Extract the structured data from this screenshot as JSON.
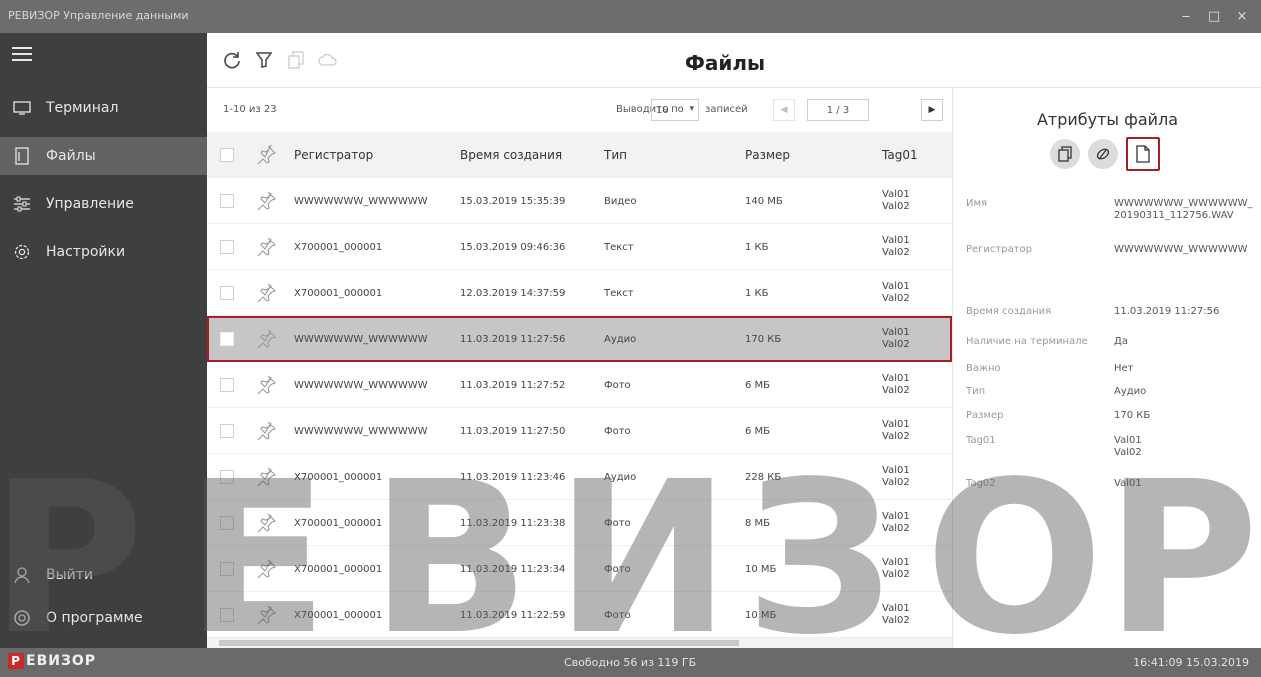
{
  "window": {
    "title": "РЕВИЗОР Управление данными",
    "buttons": [
      "‒",
      "□",
      "×"
    ]
  },
  "sidebar": {
    "items": [
      {
        "label": "Терминал",
        "icon": "terminal-icon"
      },
      {
        "label": "Файлы",
        "icon": "file-icon",
        "active": true
      },
      {
        "label": "Управление",
        "icon": "sliders-icon"
      },
      {
        "label": "Настройки",
        "icon": "gear-icon"
      }
    ],
    "bottom": [
      {
        "label": "Выйти",
        "icon": "user-icon"
      },
      {
        "label": "О программе",
        "icon": "info-icon"
      }
    ]
  },
  "toolbar": {
    "title": "Файлы",
    "icons": [
      "refresh-icon",
      "filter-icon",
      "copy-icon",
      "cloud-icon"
    ]
  },
  "pager": {
    "count": "1-10 из 23",
    "per_page_label": "Выводить по",
    "per_page_value": "10",
    "records_label": "записей",
    "page": "1 / 3"
  },
  "table": {
    "columns": [
      "Регистратор",
      "Время создания",
      "Тип",
      "Размер",
      "Tag01"
    ],
    "rows": [
      {
        "reg": "WWWWWWW_WWWWWW",
        "time": "15.03.2019 15:35:39",
        "type": "Видео",
        "size": "140 МБ",
        "tag1": "Val01",
        "tag2": "Val02"
      },
      {
        "reg": "X700001_000001",
        "time": "15.03.2019 09:46:36",
        "type": "Текст",
        "size": "1 КБ",
        "tag1": "Val01",
        "tag2": "Val02"
      },
      {
        "reg": "X700001_000001",
        "time": "12.03.2019 14:37:59",
        "type": "Текст",
        "size": "1 КБ",
        "tag1": "Val01",
        "tag2": "Val02"
      },
      {
        "reg": "WWWWWWW_WWWWWW",
        "time": "11.03.2019 11:27:56",
        "type": "Аудио",
        "size": "170 КБ",
        "tag1": "Val01",
        "tag2": "Val02",
        "selected": true
      },
      {
        "reg": "WWWWWWW_WWWWWW",
        "time": "11.03.2019 11:27:52",
        "type": "Фото",
        "size": "6 МБ",
        "tag1": "Val01",
        "tag2": "Val02"
      },
      {
        "reg": "WWWWWWW_WWWWWW",
        "time": "11.03.2019 11:27:50",
        "type": "Фото",
        "size": "6 МБ",
        "tag1": "Val01",
        "tag2": "Val02"
      },
      {
        "reg": "X700001_000001",
        "time": "11.03.2019 11:23:46",
        "type": "Аудио",
        "size": "228 КБ",
        "tag1": "Val01",
        "tag2": "Val02"
      },
      {
        "reg": "X700001_000001",
        "time": "11.03.2019 11:23:38",
        "type": "Фото",
        "size": "8 МБ",
        "tag1": "Val01",
        "tag2": "Val02"
      },
      {
        "reg": "X700001_000001",
        "time": "11.03.2019 11:23:34",
        "type": "Фото",
        "size": "10 МБ",
        "tag1": "Val01",
        "tag2": "Val02"
      },
      {
        "reg": "X700001_000001",
        "time": "11.03.2019 11:22:59",
        "type": "Фото",
        "size": "10 МБ",
        "tag1": "Val01",
        "tag2": "Val02"
      }
    ]
  },
  "attributes": {
    "title": "Атрибуты файла",
    "buttons": [
      "copy-icon",
      "erase-icon",
      "file-add-icon"
    ],
    "fields": [
      {
        "key": "Имя",
        "value": "WWWWWWW_WWWWWW_20190311_112756.WAV"
      },
      {
        "key": "Регистратор",
        "value": "WWWWWWW_WWWWWW"
      },
      {
        "key": "Время создания",
        "value": "11.03.2019 11:27:56"
      },
      {
        "key": "Наличие на терминале",
        "value": "Да"
      },
      {
        "key": "Важно",
        "value": "Нет"
      },
      {
        "key": "Тип",
        "value": "Аудио"
      },
      {
        "key": "Размер",
        "value": "170 КБ"
      },
      {
        "key": "Tag01",
        "value": "Val01\nVal02"
      },
      {
        "key": "Tag02",
        "value": "Val01"
      }
    ]
  },
  "status": {
    "logo_mark": "Р",
    "logo_text": "ЕВИЗОР",
    "free": "Свободно 56 из 119 ГБ",
    "clock": "16:41:09 15.03.2019"
  },
  "watermark": {
    "letters": [
      "Р",
      "Е",
      "В",
      "И",
      "З",
      "О",
      "Р"
    ]
  },
  "colors": {
    "accent": "#a81c23",
    "sidebar": "#3f3f3f",
    "sidebar_active": "#626262"
  }
}
